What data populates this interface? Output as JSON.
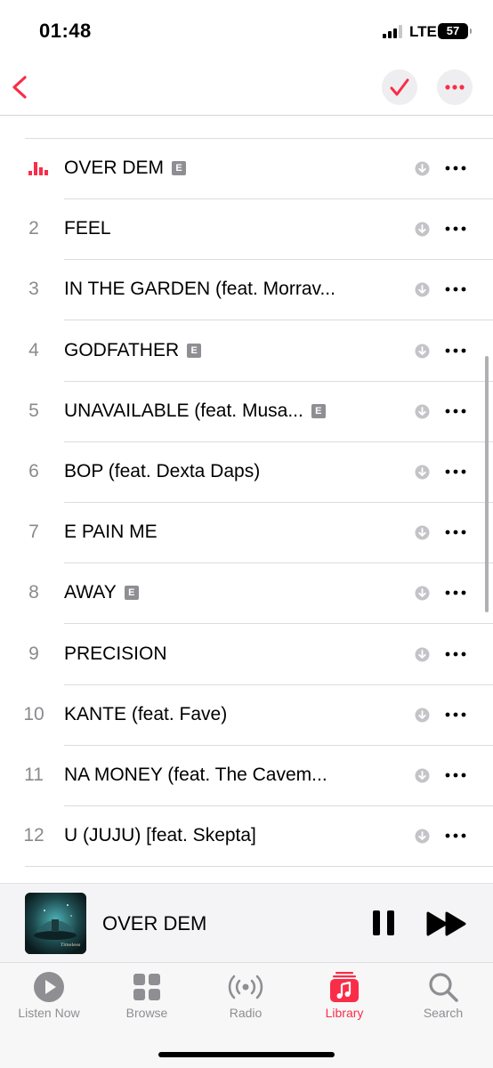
{
  "status_bar": {
    "time": "01:48",
    "network": "LTE",
    "battery": "57"
  },
  "colors": {
    "accent": "#fa2d48",
    "secondary_text": "#8a8a8e",
    "explicit_badge": "#8e8e93"
  },
  "nav": {
    "back_icon": "chevron-left-icon",
    "check_icon": "checkmark-icon",
    "more_icon": "ellipsis-icon"
  },
  "tracks": [
    {
      "number": "",
      "title": "OVER DEM",
      "explicit": true,
      "playing": true
    },
    {
      "number": "2",
      "title": "FEEL",
      "explicit": false
    },
    {
      "number": "3",
      "title": "IN THE GARDEN (feat. Morrav...",
      "explicit": false
    },
    {
      "number": "4",
      "title": "GODFATHER",
      "explicit": true
    },
    {
      "number": "5",
      "title": "UNAVAILABLE (feat. Musa...",
      "explicit": true
    },
    {
      "number": "6",
      "title": "BOP (feat. Dexta Daps)",
      "explicit": false
    },
    {
      "number": "7",
      "title": "E PAIN ME",
      "explicit": false
    },
    {
      "number": "8",
      "title": "AWAY",
      "explicit": true
    },
    {
      "number": "9",
      "title": "PRECISION",
      "explicit": false
    },
    {
      "number": "10",
      "title": "KANTE (feat. Fave)",
      "explicit": false
    },
    {
      "number": "11",
      "title": "NA MONEY (feat. The Cavem...",
      "explicit": false
    },
    {
      "number": "12",
      "title": "U (JUJU) [feat. Skepta]",
      "explicit": false
    }
  ],
  "explicit_label": "E",
  "now_playing": {
    "title": "OVER DEM",
    "artwork_text": "Timeless"
  },
  "tabs": [
    {
      "label": "Listen Now",
      "icon": "play-circle-icon",
      "active": false
    },
    {
      "label": "Browse",
      "icon": "grid-icon",
      "active": false
    },
    {
      "label": "Radio",
      "icon": "radio-waves-icon",
      "active": false
    },
    {
      "label": "Library",
      "icon": "music-library-icon",
      "active": true
    },
    {
      "label": "Search",
      "icon": "magnifier-icon",
      "active": false
    }
  ]
}
